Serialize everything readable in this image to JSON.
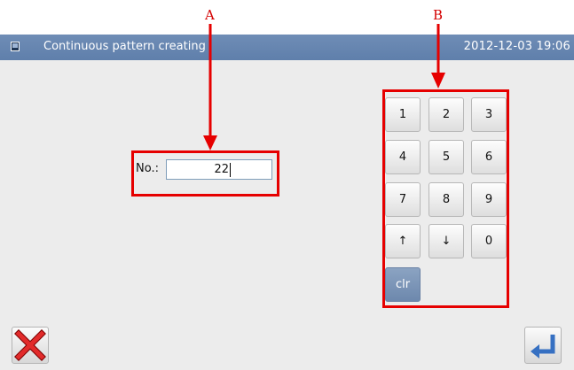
{
  "annotations": {
    "a": "A",
    "b": "B"
  },
  "window": {
    "title": "Continuous pattern creating",
    "datetime": "2012-12-03  19:06"
  },
  "form": {
    "no_label": "No.:",
    "no_value": "22"
  },
  "keypad": {
    "keys": [
      "1",
      "2",
      "3",
      "4",
      "5",
      "6",
      "7",
      "8",
      "9",
      "↑",
      "↓",
      "0"
    ],
    "clr_label": "clr"
  },
  "icons": {
    "app": "window-icon",
    "cancel": "close-x-icon",
    "enter": "enter-return-icon"
  },
  "colors": {
    "titlebar": "#6684ae",
    "annotation": "#e60000",
    "clr_key": "#7c95b8",
    "enter_arrow": "#3670c2"
  }
}
